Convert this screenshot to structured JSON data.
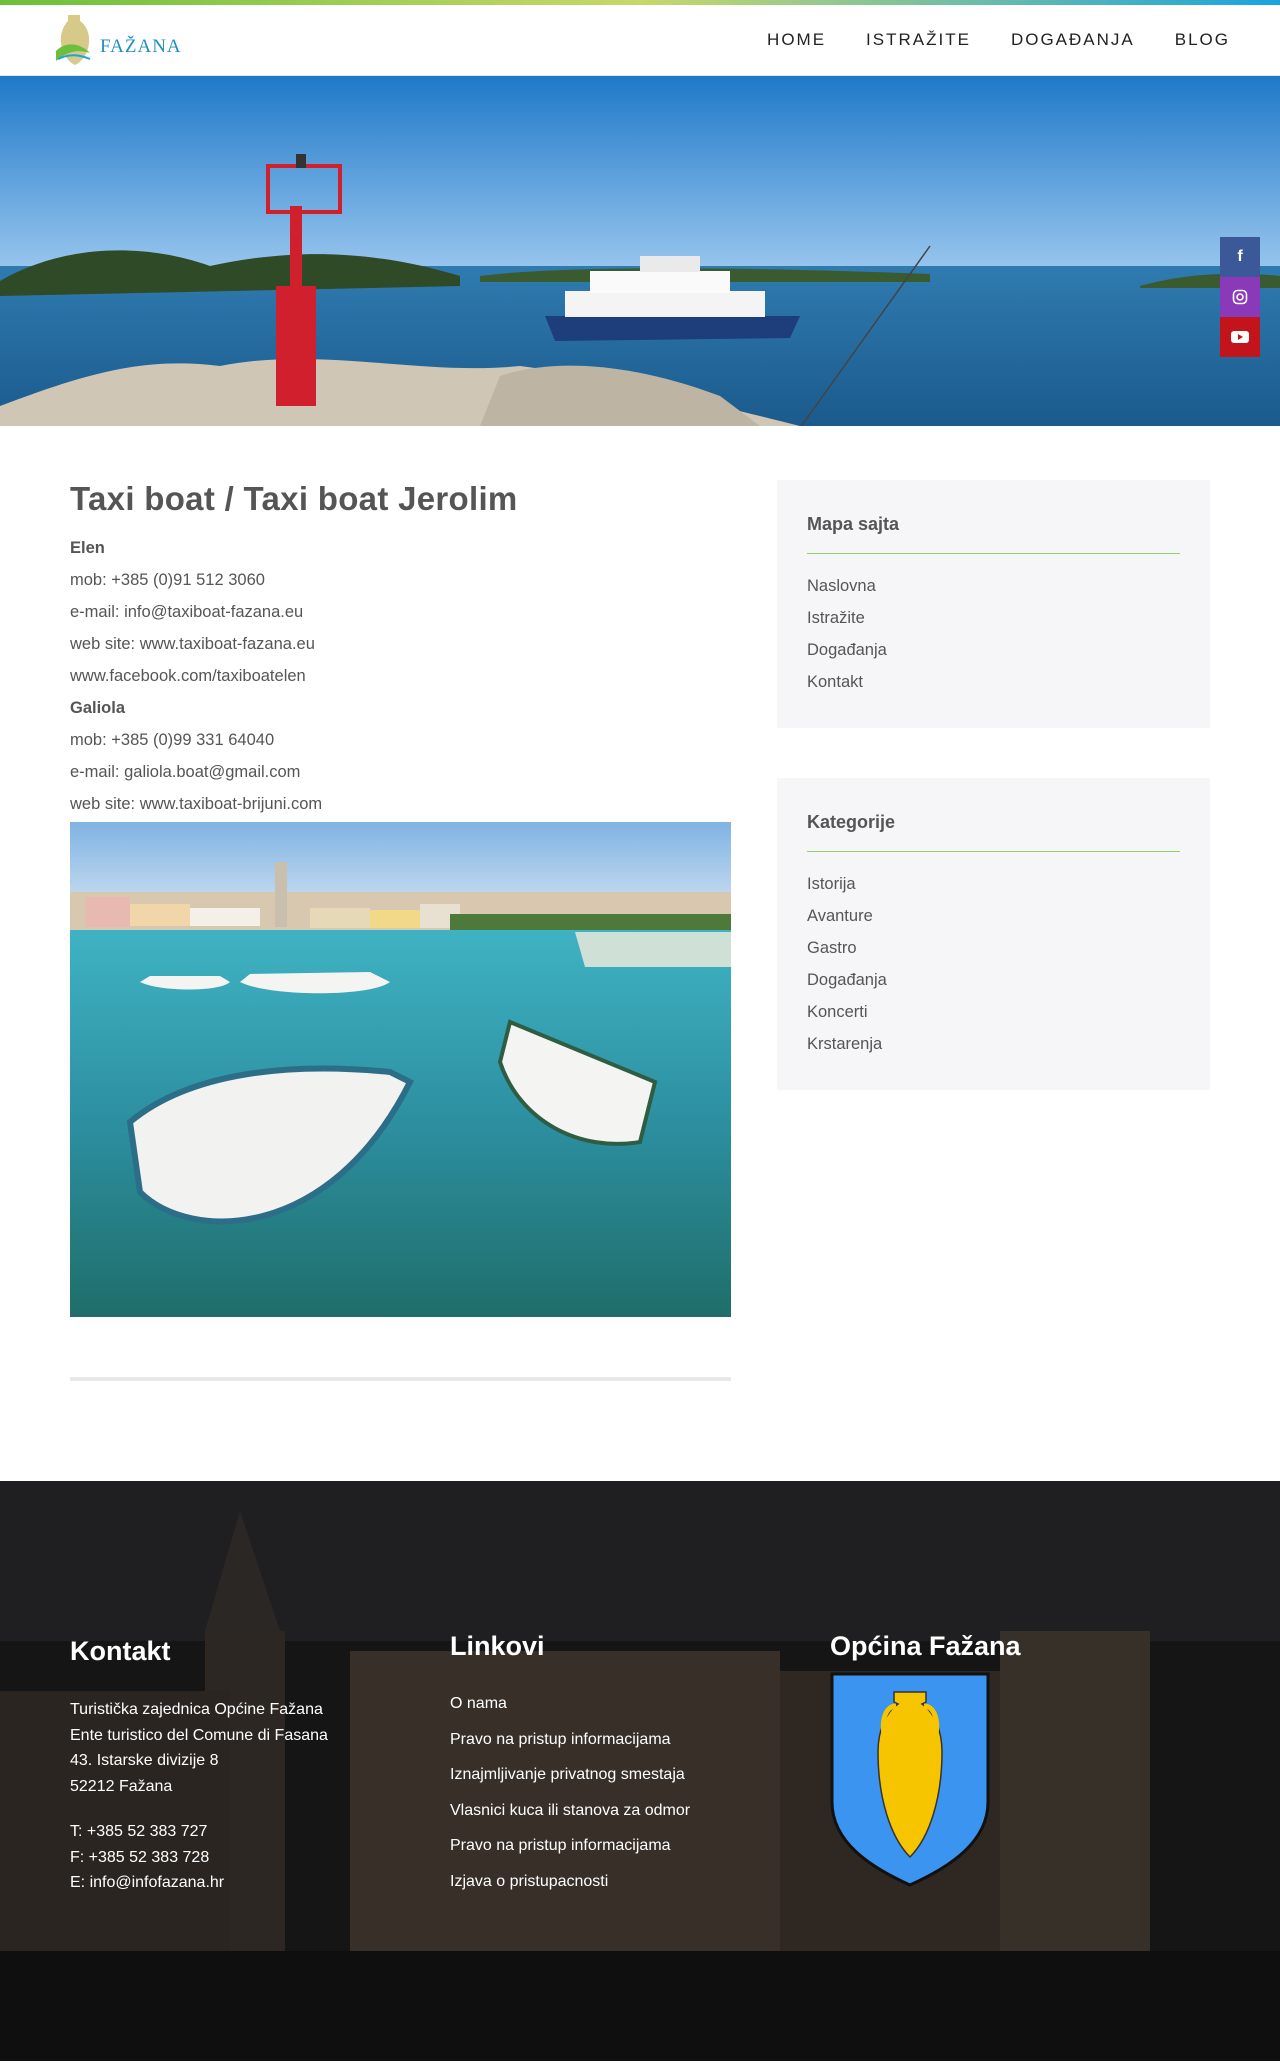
{
  "header": {
    "logo_text": "FAŽANA",
    "nav": [
      "HOME",
      "ISTRAŽITE",
      "DOGAĐANJA",
      "BLOG"
    ]
  },
  "social": {
    "facebook": "f",
    "colors": {
      "facebook": "#3b5998",
      "instagram": "#8a3ab9",
      "youtube": "#c4141b"
    }
  },
  "page": {
    "title": "Taxi boat / Taxi boat Jerolim",
    "lines": [
      "Elen",
      "mob: +385 (0)91 512 3060",
      "e-mail: info@taxiboat-fazana.eu",
      "web site: www.taxiboat-fazana.eu",
      "www.facebook.com/taxiboatelen",
      "Galiola",
      "mob: +385 (0)99 331 64040",
      "e-mail: galiola.boat@gmail.com",
      "web site: www.taxiboat-brijuni.com"
    ]
  },
  "sidebar": {
    "sitemap_title": "Mapa sajta",
    "sitemap": [
      "Naslovna",
      "Istražite",
      "Događanja",
      "Kontakt"
    ],
    "categories_title": "Kategorije",
    "categories": [
      "Istorija",
      "Avanture",
      "Gastro",
      "Događanja",
      "Koncerti",
      "Krstarenja"
    ]
  },
  "footer": {
    "contact_title": "Kontakt",
    "address": [
      "Turistička zajednica Općine Fažana",
      "Ente turistico del Comune di Fasana",
      "43. Istarske divizije 8",
      "52212 Fažana"
    ],
    "phones": [
      "T: +385 52 383 727",
      "F: +385 52 383 728",
      "E: info@infofazana.hr"
    ],
    "links_title": "Linkovi",
    "links": [
      "O nama",
      "Pravo na pristup informacijama",
      "Iznajmljivanje privatnog smestaja",
      "Vlasnici kuca ili stanova za odmor",
      "Pravo na pristup informacijama",
      "Izjava o pristupacnosti"
    ],
    "municipality_title": "Općina Fažana"
  }
}
